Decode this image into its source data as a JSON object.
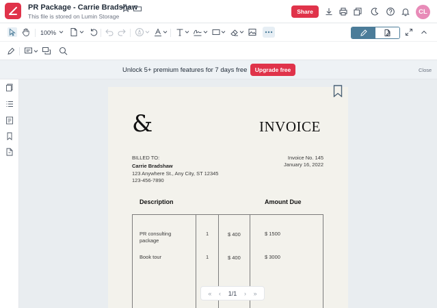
{
  "header": {
    "title": "PR Package - Carrie Bradshaw",
    "subtitle": "This file is stored on Lumin Storage",
    "share_label": "Share",
    "avatar_initials": "CL"
  },
  "toolbar": {
    "zoom_level": "100%"
  },
  "banner": {
    "text": "Unlock 5+ premium features for 7 days free",
    "upgrade_label": "Upgrade free",
    "close_label": "Close"
  },
  "invoice": {
    "title": "INVOICE",
    "logo_glyph": "&",
    "billed_to_label": "BILLED TO:",
    "client_name": "Carrie Bradshaw",
    "client_address": "123 Anywhere St., Any City, ST 12345",
    "client_phone": "123-456-7890",
    "invoice_no": "Invoice No. 145",
    "invoice_date": "January 16, 2022",
    "col_description": "Description",
    "col_amount": "Amount Due",
    "rows": [
      {
        "description_line1": "PR consulting",
        "description_line2": "package",
        "qty": "1",
        "price": "$ 400",
        "amount": "$ 1500"
      },
      {
        "description_line1": "Book tour",
        "description_line2": "",
        "qty": "1",
        "price": "$ 400",
        "amount": "$ 3000"
      }
    ]
  },
  "pager": {
    "label": "1/1"
  },
  "colors": {
    "brand_red": "#e0334a",
    "accent_blue": "#4b7c99",
    "avatar_pink": "#e88bb8"
  }
}
